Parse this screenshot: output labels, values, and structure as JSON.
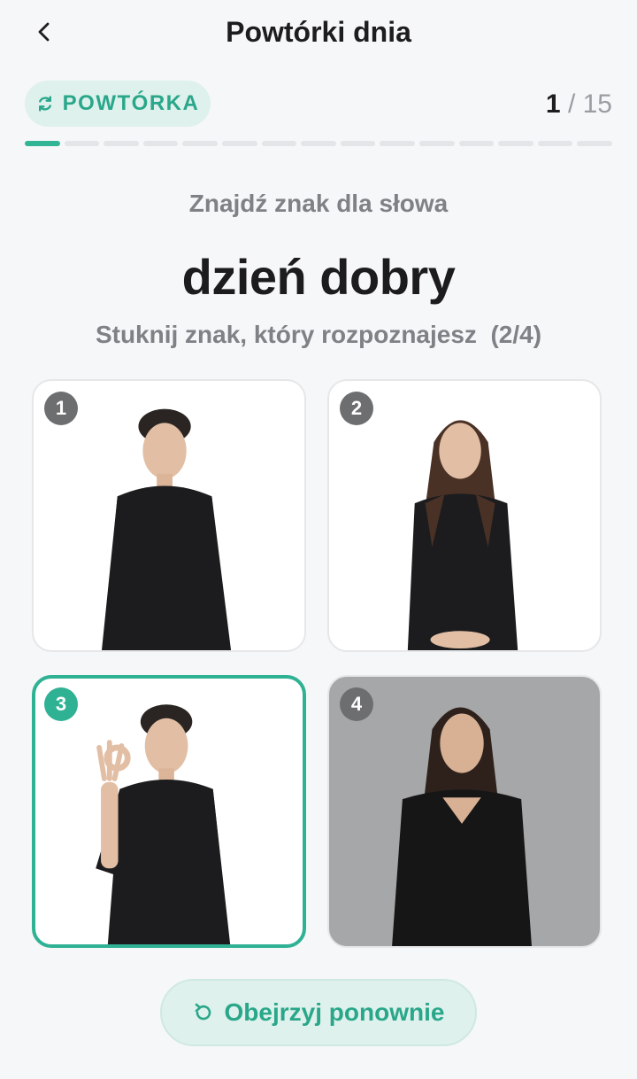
{
  "header": {
    "title": "Powtórki dnia",
    "back_icon": "chevron-left-icon"
  },
  "badge": {
    "label": "POWTÓRKA",
    "icon": "refresh-icon",
    "color": "#2aa78a",
    "bg": "#def1ec"
  },
  "counter": {
    "current": "1",
    "separator": " / ",
    "total": "15"
  },
  "progress": {
    "current": 1,
    "total": 15,
    "active_color": "#31b595"
  },
  "question": {
    "prompt": "Znajdź znak dla słowa",
    "word": "dzień dobry",
    "instruction": "Stuknij znak, który rozpoznajesz  (2/4)"
  },
  "options": [
    {
      "number": "1",
      "selected": false,
      "background": "white"
    },
    {
      "number": "2",
      "selected": false,
      "background": "white"
    },
    {
      "number": "3",
      "selected": true,
      "background": "white"
    },
    {
      "number": "4",
      "selected": false,
      "background": "gray"
    }
  ],
  "replay_button": {
    "label": "Obejrzyj ponownie",
    "icon": "replay-icon"
  },
  "colors": {
    "accent": "#2fb193",
    "background": "#f6f7f8"
  }
}
